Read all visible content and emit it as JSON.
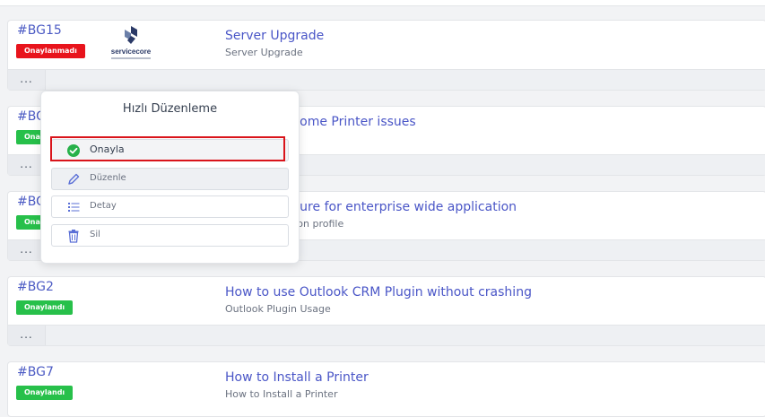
{
  "tickets": [
    {
      "id": "#BG15",
      "status": "Onaylanmadı",
      "title": "Server Upgrade",
      "subtitle": "Server Upgrade",
      "more": "...",
      "logo": "servicecore"
    },
    {
      "id": "#BG",
      "status": "Ona",
      "title": "rcome Printer issues",
      "subtitle": "",
      "more": "..."
    },
    {
      "id": "#BG",
      "status": "Ona",
      "title": "cture for enterprise wide application",
      "subtitle": "e on profile",
      "more": "..."
    },
    {
      "id": "#BG2",
      "status": "Onaylandı",
      "title": "How to use Outlook CRM Plugin without crashing",
      "subtitle": "Outlook Plugin Usage",
      "more": "..."
    },
    {
      "id": "#BG7",
      "status": "Onaylandı",
      "title": "How to Install a Printer",
      "subtitle": "How to Install a Printer",
      "more": "..."
    }
  ],
  "popover": {
    "title": "Hızlı Düzenleme",
    "items": [
      {
        "label": "Onayla",
        "icon": "check-circle-icon"
      },
      {
        "label": "Düzenle",
        "icon": "pencil-icon"
      },
      {
        "label": "Detay",
        "icon": "list-icon"
      },
      {
        "label": "Sil",
        "icon": "trash-icon"
      }
    ]
  },
  "colors": {
    "link": "#4a56c7",
    "approved": "#27c04a",
    "rejected": "#e8141c",
    "highlight": "#d9141b"
  }
}
